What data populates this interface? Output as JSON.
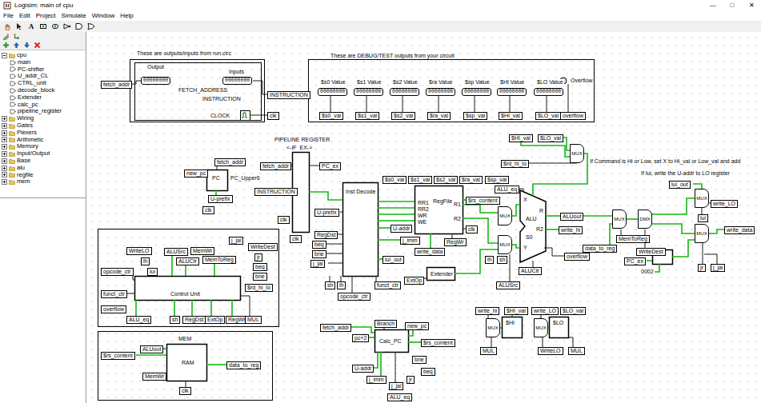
{
  "window": {
    "title": "Logisim: main of cpu",
    "controls": [
      "—",
      "□",
      "✕"
    ]
  },
  "menu": [
    "File",
    "Edit",
    "Project",
    "Simulate",
    "Window",
    "Help"
  ],
  "toolbar": {
    "text_tool": "A"
  },
  "tree": [
    {
      "label": "cpu",
      "kind": "project",
      "expanded": true,
      "selected": false
    },
    {
      "label": "main",
      "kind": "circuit",
      "expanded": false,
      "selected": false
    },
    {
      "label": "PC-shifter",
      "kind": "circuit",
      "expanded": false,
      "selected": false
    },
    {
      "label": "U_addr_CL",
      "kind": "circuit",
      "expanded": false,
      "selected": false
    },
    {
      "label": "CTRL_unit",
      "kind": "circuit",
      "expanded": false,
      "selected": false
    },
    {
      "label": "decode_block",
      "kind": "circuit",
      "expanded": false,
      "selected": false
    },
    {
      "label": "Extender",
      "kind": "circuit",
      "expanded": false,
      "selected": false
    },
    {
      "label": "calc_pc",
      "kind": "circuit",
      "expanded": false,
      "selected": false
    },
    {
      "label": "pipeline_register",
      "kind": "circuit",
      "expanded": false,
      "selected": false
    },
    {
      "label": "Wiring",
      "kind": "library",
      "expanded": false,
      "selected": false
    },
    {
      "label": "Gates",
      "kind": "library",
      "expanded": false,
      "selected": false
    },
    {
      "label": "Plexers",
      "kind": "library",
      "expanded": false,
      "selected": false
    },
    {
      "label": "Arithmetic",
      "kind": "library",
      "expanded": false,
      "selected": false
    },
    {
      "label": "Memory",
      "kind": "library",
      "expanded": false,
      "selected": false
    },
    {
      "label": "Input/Output",
      "kind": "library",
      "expanded": false,
      "selected": false
    },
    {
      "label": "Base",
      "kind": "library",
      "expanded": false,
      "selected": false
    },
    {
      "label": "alu",
      "kind": "library",
      "expanded": false,
      "selected": false
    },
    {
      "label": "regfile",
      "kind": "library",
      "expanded": false,
      "selected": false
    },
    {
      "label": "mem",
      "kind": "library",
      "expanded": false,
      "selected": false
    }
  ],
  "canvas": {
    "overflow_led": {
      "on": false
    },
    "clock": {
      "on": false
    },
    "items": [
      {
        "text": "These are outputs/inputs from run.circ",
        "kind": "label"
      },
      {
        "text": "Output",
        "kind": "label"
      },
      {
        "text": "Inputs",
        "kind": "label"
      },
      {
        "text": "FETCH_ADDRESS",
        "kind": "label"
      },
      {
        "text": "INSTRUCTION",
        "kind": "label"
      },
      {
        "text": "CLOCK",
        "kind": "label"
      },
      {
        "text": "00000000",
        "kind": "pin"
      },
      {
        "text": "00000000",
        "kind": "pin"
      },
      {
        "text": "fetch_addr",
        "kind": "tunnel"
      },
      {
        "text": "INSTRUCTION",
        "kind": "tunnel"
      },
      {
        "text": "clk",
        "kind": "tunnel"
      },
      {
        "text": "These are DEBUG/TEST outputs from your circuit",
        "kind": "label"
      },
      {
        "text": "$s0 Value",
        "kind": "label"
      },
      {
        "text": "$s1 Value",
        "kind": "label"
      },
      {
        "text": "$s2 Value",
        "kind": "label"
      },
      {
        "text": "$ra Value",
        "kind": "label"
      },
      {
        "text": "$sp Value",
        "kind": "label"
      },
      {
        "text": "$HI Value",
        "kind": "label"
      },
      {
        "text": "$LO Value",
        "kind": "label"
      },
      {
        "text": "Overflow",
        "kind": "label"
      },
      {
        "text": "00000000",
        "kind": "pin"
      },
      {
        "text": "00000000",
        "kind": "pin"
      },
      {
        "text": "00000000",
        "kind": "pin"
      },
      {
        "text": "00000000",
        "kind": "pin"
      },
      {
        "text": "00000000",
        "kind": "pin"
      },
      {
        "text": "00000000",
        "kind": "pin"
      },
      {
        "text": "00000000",
        "kind": "pin"
      },
      {
        "text": "$s0_val",
        "kind": "tunnel"
      },
      {
        "text": "$s1_val",
        "kind": "tunnel"
      },
      {
        "text": "$s2_val",
        "kind": "tunnel"
      },
      {
        "text": "$ra_val",
        "kind": "tunnel"
      },
      {
        "text": "$sp_val",
        "kind": "tunnel"
      },
      {
        "text": "$HI_val",
        "kind": "tunnel"
      },
      {
        "text": "$LO_val",
        "kind": "tunnel"
      },
      {
        "text": "overflow",
        "kind": "tunnel"
      },
      {
        "text": "PIPELINE REGISTER",
        "kind": "label"
      },
      {
        "text": "<-IF  EX->",
        "kind": "label"
      },
      {
        "text": "fetch_addr",
        "kind": "tunnel"
      },
      {
        "text": "PC_ex",
        "kind": "tunnel"
      },
      {
        "text": "INSTRUCTION",
        "kind": "tunnel"
      },
      {
        "text": "clk",
        "kind": "tunnel"
      },
      {
        "text": "clk",
        "kind": "tunnel"
      },
      {
        "text": "fetch_addr",
        "kind": "tunnel"
      },
      {
        "text": "new_pc",
        "kind": "tunnel"
      },
      {
        "text": "PC",
        "kind": "label"
      },
      {
        "text": "PC_Upper6",
        "kind": "label"
      },
      {
        "text": "U-prefix",
        "kind": "tunnel"
      },
      {
        "text": "clk",
        "kind": "tunnel"
      },
      {
        "text": "Inst Decode",
        "kind": "label"
      },
      {
        "text": "U-prefix",
        "kind": "tunnel"
      },
      {
        "text": "RegDst",
        "kind": "tunnel"
      },
      {
        "text": "beq",
        "kind": "tunnel"
      },
      {
        "text": "bne",
        "kind": "tunnel"
      },
      {
        "text": "j_jal",
        "kind": "tunnel"
      },
      {
        "text": "sh",
        "kind": "tunnel"
      },
      {
        "text": "lh",
        "kind": "tunnel"
      },
      {
        "text": "opcode_ctr",
        "kind": "tunnel"
      },
      {
        "text": "funct_ctr",
        "kind": "tunnel"
      },
      {
        "text": "lui_out",
        "kind": "tunnel"
      },
      {
        "text": "j_imm",
        "kind": "tunnel"
      },
      {
        "text": "U-addr",
        "kind": "tunnel"
      },
      {
        "text": "$s0_val",
        "kind": "tunnel"
      },
      {
        "text": "$s1_val",
        "kind": "tunnel"
      },
      {
        "text": "$s2_val",
        "kind": "tunnel"
      },
      {
        "text": "$ra_val",
        "kind": "tunnel"
      },
      {
        "text": "$sp_val",
        "kind": "tunnel"
      },
      {
        "text": "$rs_content",
        "kind": "tunnel"
      },
      {
        "text": "RegFile",
        "kind": "label"
      },
      {
        "text": "RR1",
        "kind": "label"
      },
      {
        "text": "RR2",
        "kind": "label"
      },
      {
        "text": "WR",
        "kind": "label"
      },
      {
        "text": "WE",
        "kind": "label"
      },
      {
        "text": "R1",
        "kind": "label"
      },
      {
        "text": "R2",
        "kind": "label"
      },
      {
        "text": "clk",
        "kind": "tunnel"
      },
      {
        "text": "RegWr",
        "kind": "tunnel"
      },
      {
        "text": "write_data",
        "kind": "tunnel"
      },
      {
        "text": "Extender",
        "kind": "label"
      },
      {
        "text": "ExtOp",
        "kind": "tunnel"
      },
      {
        "text": "lh",
        "kind": "tunnel"
      },
      {
        "text": "sh",
        "kind": "tunnel"
      },
      {
        "text": "ALUSrc",
        "kind": "tunnel"
      },
      {
        "text": "$HI_val",
        "kind": "tunnel"
      },
      {
        "text": "$LO_val",
        "kind": "tunnel"
      },
      {
        "text": "$rd_hi_lo",
        "kind": "tunnel"
      },
      {
        "text": "If Command is Hi or Low, set X to Hi_val or Low_val and add",
        "kind": "label"
      },
      {
        "text": "ALU_eq",
        "kind": "tunnel"
      },
      {
        "text": "ALU",
        "kind": "label"
      },
      {
        "text": "X",
        "kind": "label"
      },
      {
        "text": "R",
        "kind": "label"
      },
      {
        "text": "R2",
        "kind": "label"
      },
      {
        "text": "S0",
        "kind": "label"
      },
      {
        "text": "Y",
        "kind": "label"
      },
      {
        "text": "ALUout",
        "kind": "tunnel"
      },
      {
        "text": "write_hi",
        "kind": "tunnel"
      },
      {
        "text": "overflow",
        "kind": "tunnel"
      },
      {
        "text": "ALUCtr",
        "kind": "tunnel"
      },
      {
        "text": "If lui, write the U-addr to LO register",
        "kind": "label"
      },
      {
        "text": "lui_out",
        "kind": "tunnel"
      },
      {
        "text": "write_LO",
        "kind": "tunnel"
      },
      {
        "text": "lui",
        "kind": "tunnel"
      },
      {
        "text": "MemToReg",
        "kind": "tunnel"
      },
      {
        "text": "data_to_reg",
        "kind": "tunnel"
      },
      {
        "text": "WriteDest",
        "kind": "tunnel"
      },
      {
        "text": "write_data",
        "kind": "tunnel"
      },
      {
        "text": "PC_ex",
        "kind": "tunnel"
      },
      {
        "text": "0002",
        "kind": "label"
      },
      {
        "text": "jr",
        "kind": "tunnel"
      },
      {
        "text": "j_jal",
        "kind": "tunnel"
      },
      {
        "text": "WriteLO",
        "kind": "tunnel"
      },
      {
        "text": "lh",
        "kind": "tunnel"
      },
      {
        "text": "lui",
        "kind": "tunnel"
      },
      {
        "text": "ALUSrc",
        "kind": "tunnel"
      },
      {
        "text": "ALUCtr",
        "kind": "tunnel"
      },
      {
        "text": "MemWr",
        "kind": "tunnel"
      },
      {
        "text": "MemToReg",
        "kind": "tunnel"
      },
      {
        "text": "j_jal",
        "kind": "tunnel"
      },
      {
        "text": "WriteDest",
        "kind": "tunnel"
      },
      {
        "text": "jr",
        "kind": "tunnel"
      },
      {
        "text": "beq",
        "kind": "tunnel"
      },
      {
        "text": "bne",
        "kind": "tunnel"
      },
      {
        "text": "$rd_hi_lo",
        "kind": "tunnel"
      },
      {
        "text": "opcode_ctr",
        "kind": "tunnel"
      },
      {
        "text": "funct_ctr",
        "kind": "tunnel"
      },
      {
        "text": "Control Unit",
        "kind": "label"
      },
      {
        "text": "overflow",
        "kind": "tunnel"
      },
      {
        "text": "ALU_eq",
        "kind": "tunnel"
      },
      {
        "text": "sh",
        "kind": "tunnel"
      },
      {
        "text": "RegDst",
        "kind": "tunnel"
      },
      {
        "text": "ExtOp",
        "kind": "tunnel"
      },
      {
        "text": "RegWr",
        "kind": "tunnel"
      },
      {
        "text": "MUL",
        "kind": "tunnel"
      },
      {
        "text": "MEM",
        "kind": "label"
      },
      {
        "text": "RAM",
        "kind": "label"
      },
      {
        "text": "$rs_content",
        "kind": "tunnel"
      },
      {
        "text": "ALUout",
        "kind": "tunnel"
      },
      {
        "text": "MemWr",
        "kind": "tunnel"
      },
      {
        "text": "clk",
        "kind": "tunnel"
      },
      {
        "text": "data_to_reg",
        "kind": "tunnel"
      },
      {
        "text": "fetch_addr",
        "kind": "tunnel"
      },
      {
        "text": "Branch",
        "kind": "tunnel"
      },
      {
        "text": "new_pc",
        "kind": "tunnel"
      },
      {
        "text": "$rs_content",
        "kind": "tunnel"
      },
      {
        "text": "pc+2",
        "kind": "tunnel"
      },
      {
        "text": "Calc_PC",
        "kind": "label"
      },
      {
        "text": "bne",
        "kind": "tunnel"
      },
      {
        "text": "U-addr",
        "kind": "tunnel"
      },
      {
        "text": "j_imm",
        "kind": "tunnel"
      },
      {
        "text": "j_jal",
        "kind": "tunnel"
      },
      {
        "text": "jr",
        "kind": "tunnel"
      },
      {
        "text": "beq",
        "kind": "tunnel"
      },
      {
        "text": "ALU_eq",
        "kind": "tunnel"
      },
      {
        "text": "write_hi",
        "kind": "tunnel"
      },
      {
        "text": "$HI_val",
        "kind": "tunnel"
      },
      {
        "text": "write_LO",
        "kind": "tunnel"
      },
      {
        "text": "$LO_val",
        "kind": "tunnel"
      },
      {
        "text": "$HI",
        "kind": "label"
      },
      {
        "text": "$LO",
        "kind": "label"
      },
      {
        "text": "MUL",
        "kind": "tunnel"
      },
      {
        "text": "WriteLO",
        "kind": "tunnel"
      },
      {
        "text": "MUL",
        "kind": "tunnel"
      },
      {
        "text": "MUX",
        "kind": "mux"
      },
      {
        "text": "MUX",
        "kind": "mux"
      },
      {
        "text": "MUX",
        "kind": "mux"
      },
      {
        "text": "MUX",
        "kind": "mux"
      },
      {
        "text": "DMX",
        "kind": "mux"
      },
      {
        "text": "MUX",
        "kind": "mux"
      },
      {
        "text": "MUX",
        "kind": "mux"
      },
      {
        "text": "MUX",
        "kind": "mux"
      },
      {
        "text": "MUX",
        "kind": "mux"
      }
    ]
  }
}
